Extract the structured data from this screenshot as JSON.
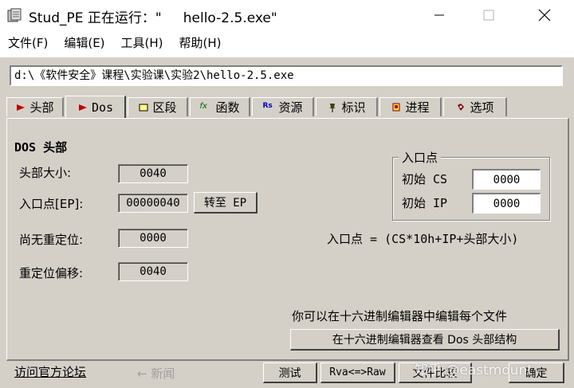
{
  "window": {
    "title": "Stud_PE 正在运行：\"     hello-2.5.exe\""
  },
  "menu": {
    "items": [
      "文件(F)",
      "编辑(E)",
      "工具(H)",
      "帮助(H)"
    ]
  },
  "path": "d:\\《软件安全》课程\\实验课\\实验2\\hello-2.5.exe",
  "tabs": [
    {
      "label": "头部",
      "active": false
    },
    {
      "label": "Dos",
      "active": true
    },
    {
      "label": "区段",
      "active": false
    },
    {
      "label": "函数",
      "active": false
    },
    {
      "label": "资源",
      "active": false
    },
    {
      "label": "标识",
      "active": false
    },
    {
      "label": "进程",
      "active": false
    },
    {
      "label": "选项",
      "active": false
    }
  ],
  "tab_icons": [
    "arrow",
    "arrow",
    "box",
    "fx",
    "rs",
    "pin",
    "flag",
    "gear"
  ],
  "dos": {
    "section_title": "DOS 头部",
    "header_size_label": "头部大小:",
    "header_size": "0040",
    "entry_label": "入口点[EP]:",
    "entry_value": "00000040",
    "goto_ep": "转至 EP",
    "no_reloc_label": "尚无重定位:",
    "no_reloc_value": "0000",
    "reloc_offset_label": "重定位偏移:",
    "reloc_offset_value": "0040"
  },
  "entry_group": {
    "title": "入口点",
    "cs_label": "初始 CS",
    "cs_value": "0000",
    "ip_label": "初始 IP",
    "ip_value": "0000",
    "formula": "入口点 = (CS*10h+IP+头部大小)"
  },
  "hex": {
    "hint": "你可以在十六进制编辑器中编辑每个文件",
    "button": "在十六进制编辑器查看 Dos 头部结构"
  },
  "footer": {
    "visit_site": "访问官方论坛",
    "news": "← 新闻",
    "test": "测试",
    "rva": "Rva<=>Raw",
    "file_compare": "文件比较",
    "ok": "确定"
  },
  "watermark": "知乎 @eastmount"
}
